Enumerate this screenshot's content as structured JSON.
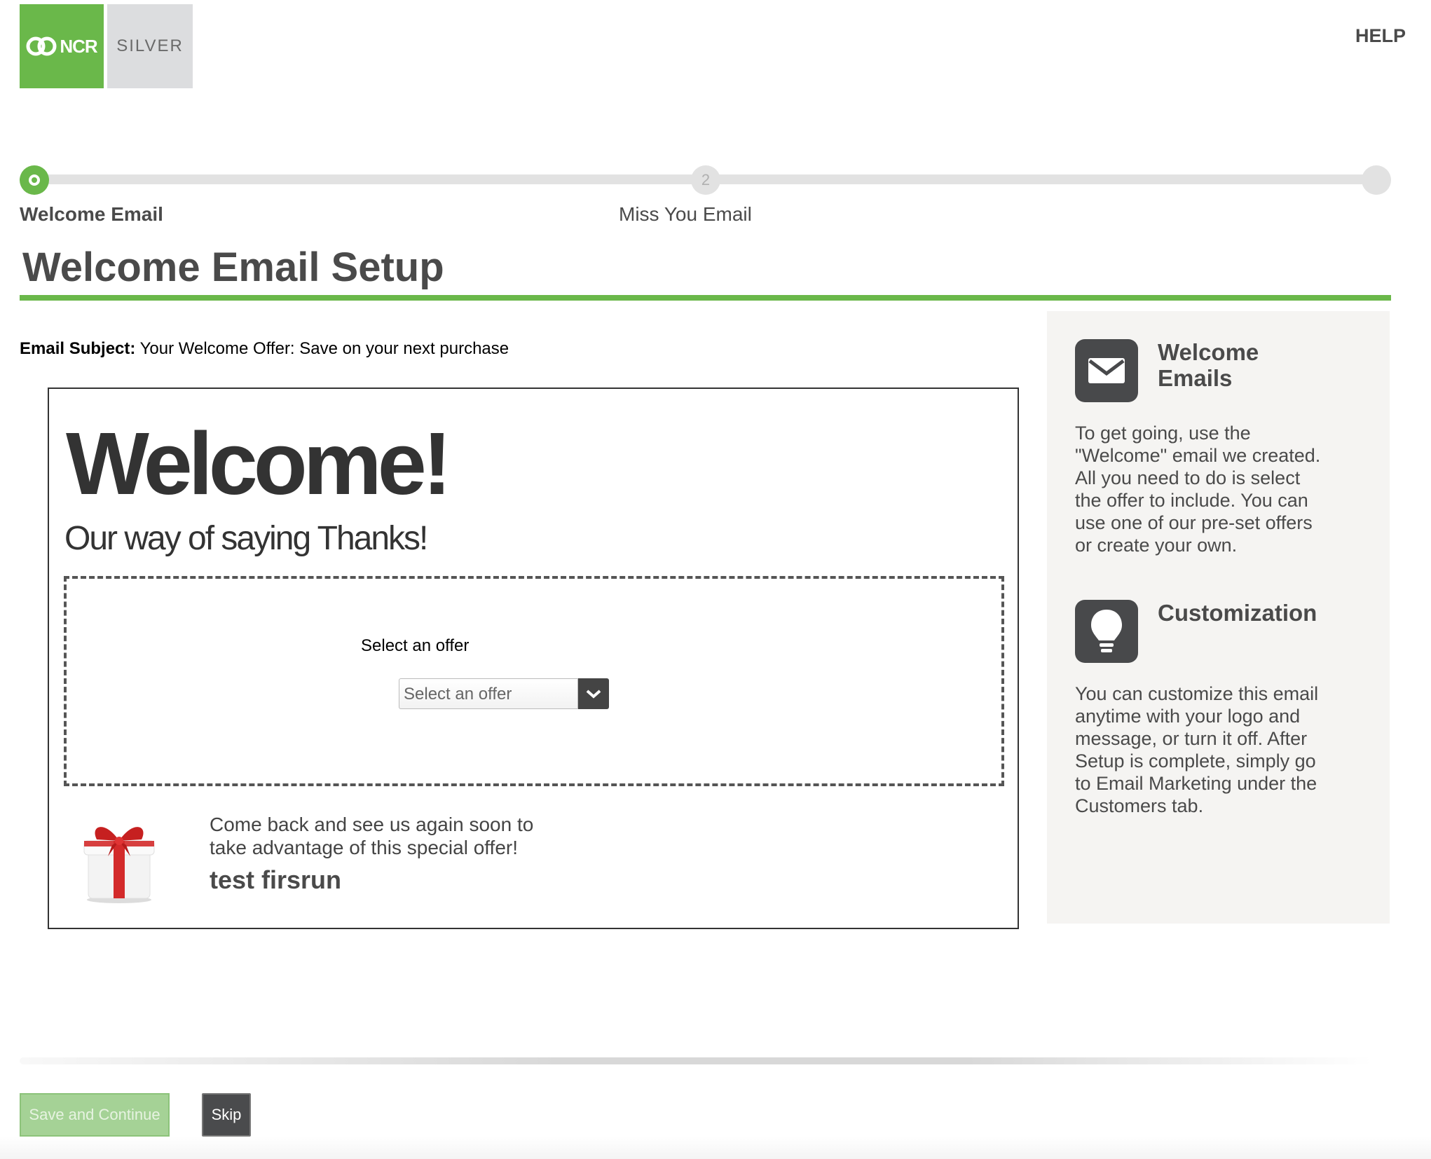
{
  "brand": {
    "ncr_logo": "NCR",
    "silver_logo": "SILVER",
    "ncr_color": "#6ab84a",
    "silver_bg": "#dcdddf"
  },
  "header": {
    "help_label": "HELP"
  },
  "stepper": {
    "steps": [
      {
        "label": "Welcome Email",
        "state": "active"
      },
      {
        "label": "Miss You Email",
        "number": "2",
        "state": "upcoming"
      },
      {
        "label": "",
        "state": "upcoming"
      }
    ]
  },
  "page": {
    "title": "Welcome Email Setup",
    "accent_color": "#6ab84a"
  },
  "email": {
    "subject_label": "Email Subject:",
    "subject_value": "Your Welcome Offer: Save on your next purchase",
    "headline": "Welcome!",
    "subheadline": "Our way of saying Thanks!",
    "offer_prompt": "Select an offer",
    "offer_select_placeholder": "Select an offer",
    "closing_line_1": "Come back and see us again soon to",
    "closing_line_2": "take advantage of this special offer!",
    "store_name": "test firsrun",
    "gift_icon": "gift-box-icon"
  },
  "sidebar": {
    "sections": [
      {
        "icon": "envelope-icon",
        "heading": "Welcome Emails",
        "text": "To get going, use the \"Welcome\" email we created. All you need to do is select the offer to include. You can use one of our pre-set offers or create your own."
      },
      {
        "icon": "lightbulb-icon",
        "heading": "Customization",
        "text": "You can customize this email anytime with your logo and message, or turn it off. After Setup is complete, simply go to Email Marketing under the Customers tab."
      }
    ]
  },
  "footer": {
    "save_label": "Save and Continue",
    "skip_label": "Skip"
  }
}
